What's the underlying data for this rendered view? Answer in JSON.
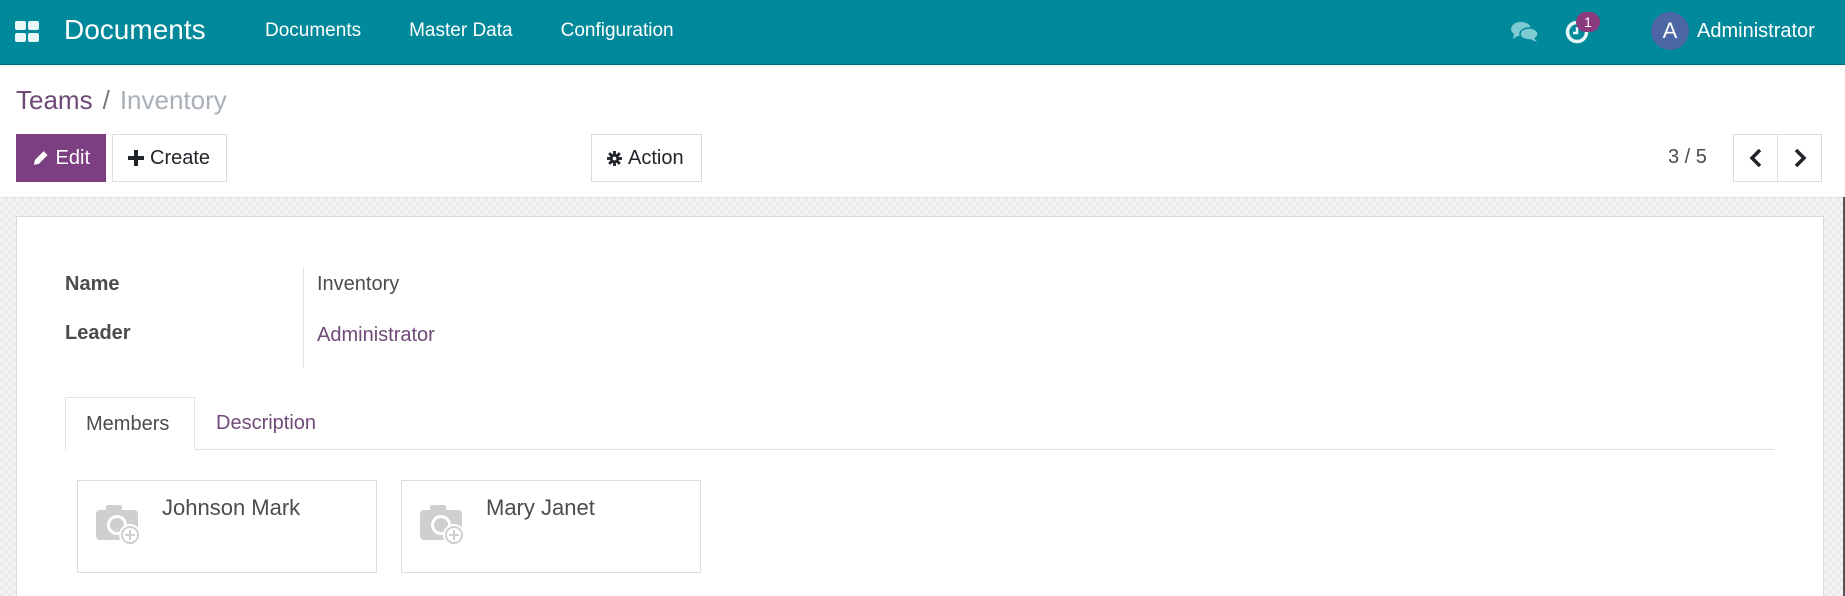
{
  "navbar": {
    "app_name": "Documents",
    "menu": [
      {
        "label": "Documents"
      },
      {
        "label": "Master Data"
      },
      {
        "label": "Configuration"
      }
    ],
    "activity_count": "1",
    "user": {
      "initial": "A",
      "name": "Administrator"
    },
    "icons": {
      "apps": "apps-grid-icon",
      "chat": "chat-bubbles-icon",
      "activity": "clock-icon"
    }
  },
  "breadcrumb": {
    "parent": "Teams",
    "separator": "/",
    "current": "Inventory"
  },
  "toolbar": {
    "edit_label": "Edit",
    "create_label": "Create",
    "action_label": "Action",
    "pager": "3 / 5"
  },
  "form": {
    "fields": [
      {
        "label": "Name",
        "value": "Inventory"
      },
      {
        "label": "Leader",
        "value": "Administrator"
      }
    ],
    "tabs": [
      {
        "label": "Members",
        "active": true
      },
      {
        "label": "Description",
        "active": false
      }
    ],
    "members": [
      {
        "name": "Johnson Mark"
      },
      {
        "name": "Mary Janet"
      }
    ]
  },
  "colors": {
    "navbar": "#00899a",
    "primary": "#7c3f82",
    "link": "#6f4a78",
    "badge": "#8b3a7e",
    "avatar": "#4d66a6"
  }
}
